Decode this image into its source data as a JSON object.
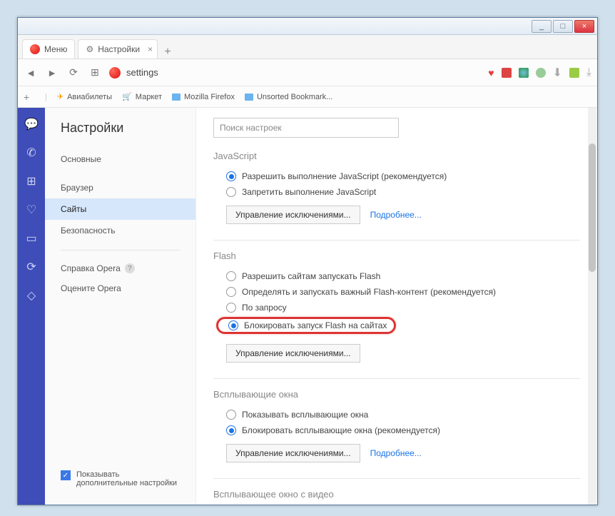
{
  "titlebar": {
    "min": "_",
    "max": "□",
    "close": "×"
  },
  "tabs": {
    "menu": "Меню",
    "settings": "Настройки"
  },
  "address": {
    "text": "settings"
  },
  "bookmarks": {
    "items": [
      "Авиабилеты",
      "Маркет",
      "Mozilla Firefox",
      "Unsorted Bookmark..."
    ]
  },
  "sidebar": {
    "title": "Настройки",
    "items": [
      "Основные",
      "Браузер",
      "Сайты",
      "Безопасность"
    ],
    "help": "Справка Opera",
    "rate": "Оцените Opera",
    "showadv": "Показывать дополнительные настройки"
  },
  "main": {
    "search_placeholder": "Поиск настроек",
    "js": {
      "title": "JavaScript",
      "allow": "Разрешить выполнение JavaScript (рекомендуется)",
      "deny": "Запретить выполнение JavaScript",
      "manage": "Управление исключениями...",
      "more": "Подробнее..."
    },
    "flash": {
      "title": "Flash",
      "allow": "Разрешить сайтам запускать Flash",
      "detect": "Определять и запускать важный Flash-контент (рекомендуется)",
      "ondemand": "По запросу",
      "block": "Блокировать запуск Flash на сайтах",
      "manage": "Управление исключениями..."
    },
    "popups": {
      "title": "Всплывающие окна",
      "show": "Показывать всплывающие окна",
      "block": "Блокировать всплывающие окна (рекомендуется)",
      "manage": "Управление исключениями...",
      "more": "Подробнее..."
    },
    "popupvideo": {
      "title": "Всплывающее окно с видео"
    }
  }
}
